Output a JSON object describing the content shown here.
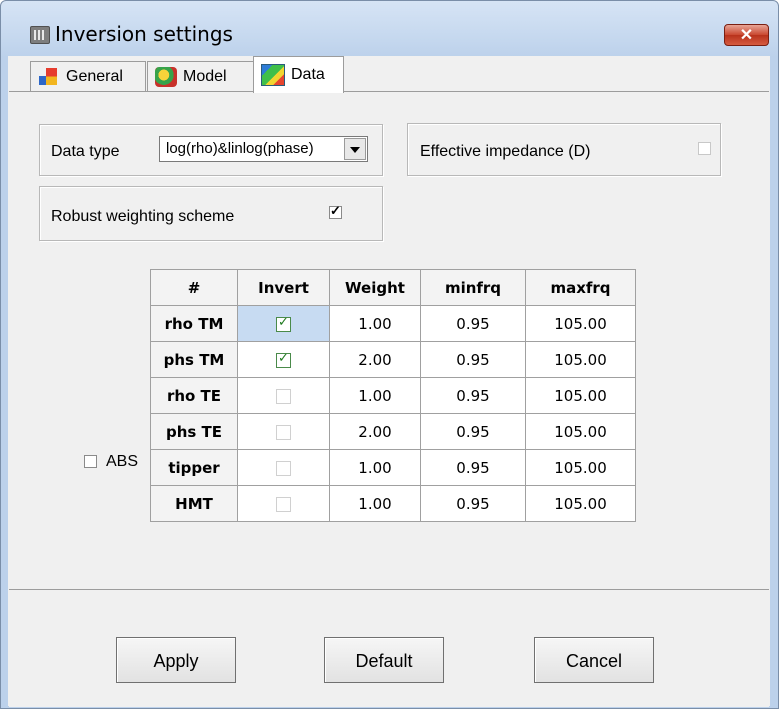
{
  "window": {
    "title": "Inversion settings",
    "close_glyph": "✕"
  },
  "tabs": [
    {
      "label": "General",
      "icon": "general-icon",
      "active": false
    },
    {
      "label": "Model",
      "icon": "model-icon",
      "active": false
    },
    {
      "label": "Data",
      "icon": "data-icon",
      "active": true
    }
  ],
  "data_type": {
    "label": "Data type",
    "value": "log(rho)&linlog(phase)"
  },
  "effective_impedance": {
    "label": "Effective impedance (D)",
    "checked": false
  },
  "robust_weighting": {
    "label": "Robust weighting scheme",
    "checked": true
  },
  "abs": {
    "label": "ABS",
    "checked": false
  },
  "grid": {
    "headers": [
      "#",
      "Invert",
      "Weight",
      "minfrq",
      "maxfrq"
    ],
    "rows": [
      {
        "name": "rho TM",
        "invert": true,
        "weight": "1.00",
        "minfrq": "0.95",
        "maxfrq": "105.00"
      },
      {
        "name": "phs TM",
        "invert": true,
        "weight": "2.00",
        "minfrq": "0.95",
        "maxfrq": "105.00"
      },
      {
        "name": "rho TE",
        "invert": false,
        "weight": "1.00",
        "minfrq": "0.95",
        "maxfrq": "105.00"
      },
      {
        "name": "phs TE",
        "invert": false,
        "weight": "2.00",
        "minfrq": "0.95",
        "maxfrq": "105.00"
      },
      {
        "name": "tipper",
        "invert": false,
        "weight": "1.00",
        "minfrq": "0.95",
        "maxfrq": "105.00"
      },
      {
        "name": "HMT",
        "invert": false,
        "weight": "1.00",
        "minfrq": "0.95",
        "maxfrq": "105.00"
      }
    ]
  },
  "buttons": {
    "apply": "Apply",
    "default": "Default",
    "cancel": "Cancel"
  }
}
